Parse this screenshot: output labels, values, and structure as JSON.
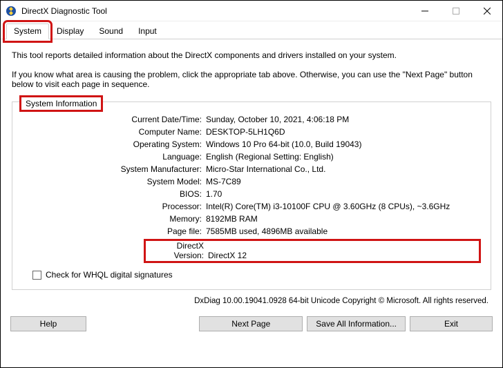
{
  "window": {
    "title": "DirectX Diagnostic Tool"
  },
  "tabs": {
    "system": "System",
    "display": "Display",
    "sound": "Sound",
    "input": "Input"
  },
  "desc": {
    "line1": "This tool reports detailed information about the DirectX components and drivers installed on your system.",
    "line2": "If you know what area is causing the problem, click the appropriate tab above.  Otherwise, you can use the \"Next Page\" button below to visit each page in sequence."
  },
  "sysinfo": {
    "legend": "System Information",
    "labels": {
      "datetime": "Current Date/Time:",
      "computer": "Computer Name:",
      "os": "Operating System:",
      "lang": "Language:",
      "mfr": "System Manufacturer:",
      "model": "System Model:",
      "bios": "BIOS:",
      "proc": "Processor:",
      "mem": "Memory:",
      "page": "Page file:",
      "dx": "DirectX Version:"
    },
    "values": {
      "datetime": "Sunday, October 10, 2021, 4:06:18 PM",
      "computer": "DESKTOP-5LH1Q6D",
      "os": "Windows 10 Pro 64-bit (10.0, Build 19043)",
      "lang": "English (Regional Setting: English)",
      "mfr": "Micro-Star International Co., Ltd.",
      "model": "MS-7C89",
      "bios": "1.70",
      "proc": "Intel(R) Core(TM) i3-10100F CPU @ 3.60GHz (8 CPUs), ~3.6GHz",
      "mem": "8192MB RAM",
      "page": "7585MB used, 4896MB available",
      "dx": "DirectX 12"
    },
    "whql": "Check for WHQL digital signatures"
  },
  "footer": "DxDiag 10.00.19041.0928 64-bit Unicode   Copyright © Microsoft. All rights reserved.",
  "buttons": {
    "help": "Help",
    "next": "Next Page",
    "save": "Save All Information...",
    "exit": "Exit"
  }
}
